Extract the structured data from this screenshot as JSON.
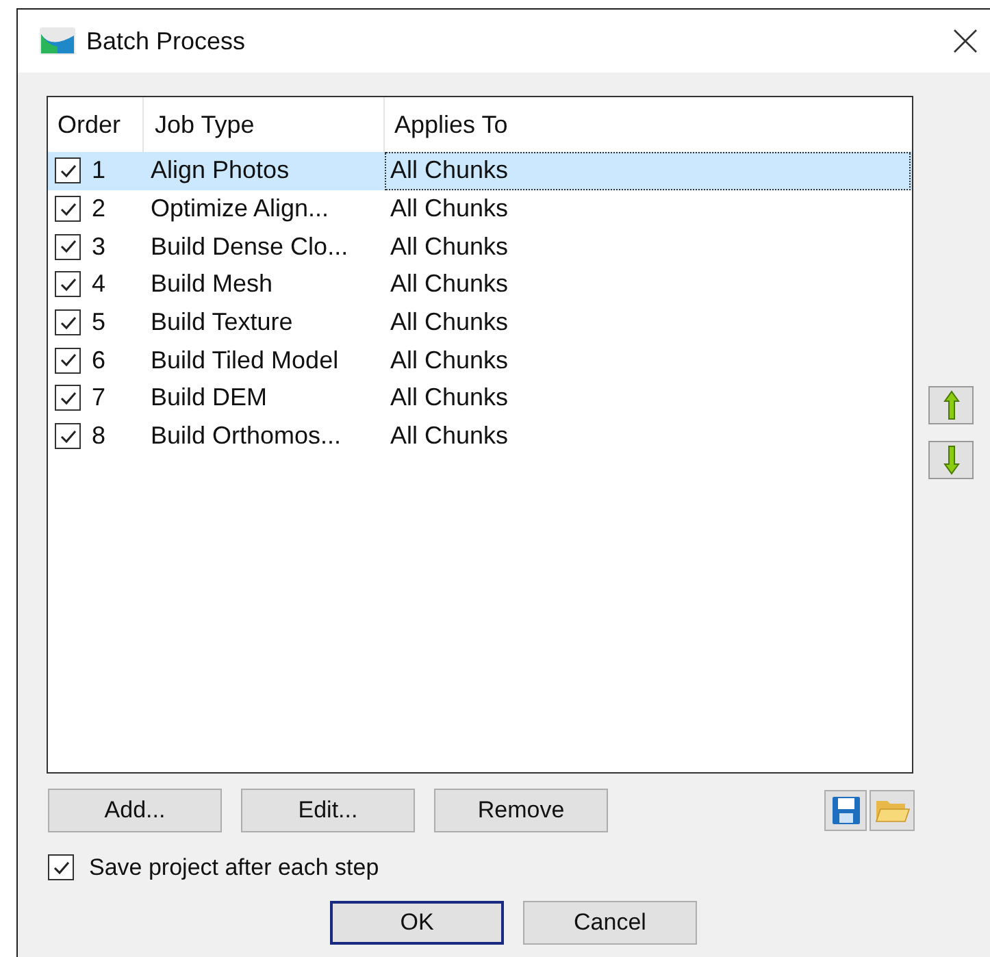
{
  "window": {
    "title": "Batch Process"
  },
  "table": {
    "columns": [
      "Order",
      "Job Type",
      "Applies To"
    ],
    "rows": [
      {
        "checked": true,
        "order": "1",
        "job_type": "Align Photos",
        "applies_to": "All Chunks",
        "selected": true
      },
      {
        "checked": true,
        "order": "2",
        "job_type": "Optimize Align...",
        "applies_to": "All Chunks",
        "selected": false
      },
      {
        "checked": true,
        "order": "3",
        "job_type": "Build Dense Clo...",
        "applies_to": "All Chunks",
        "selected": false
      },
      {
        "checked": true,
        "order": "4",
        "job_type": "Build Mesh",
        "applies_to": "All Chunks",
        "selected": false
      },
      {
        "checked": true,
        "order": "5",
        "job_type": "Build Texture",
        "applies_to": "All Chunks",
        "selected": false
      },
      {
        "checked": true,
        "order": "6",
        "job_type": "Build Tiled Model",
        "applies_to": "All Chunks",
        "selected": false
      },
      {
        "checked": true,
        "order": "7",
        "job_type": "Build DEM",
        "applies_to": "All Chunks",
        "selected": false
      },
      {
        "checked": true,
        "order": "8",
        "job_type": "Build Orthomos...",
        "applies_to": "All Chunks",
        "selected": false
      }
    ]
  },
  "buttons": [
    "Add...",
    "Edit...",
    "Remove"
  ],
  "save_option": {
    "label": "Save project after each step",
    "checked": true
  },
  "dialog_buttons": [
    {
      "label": "OK",
      "default": true
    },
    {
      "label": "Cancel",
      "default": false
    }
  ]
}
